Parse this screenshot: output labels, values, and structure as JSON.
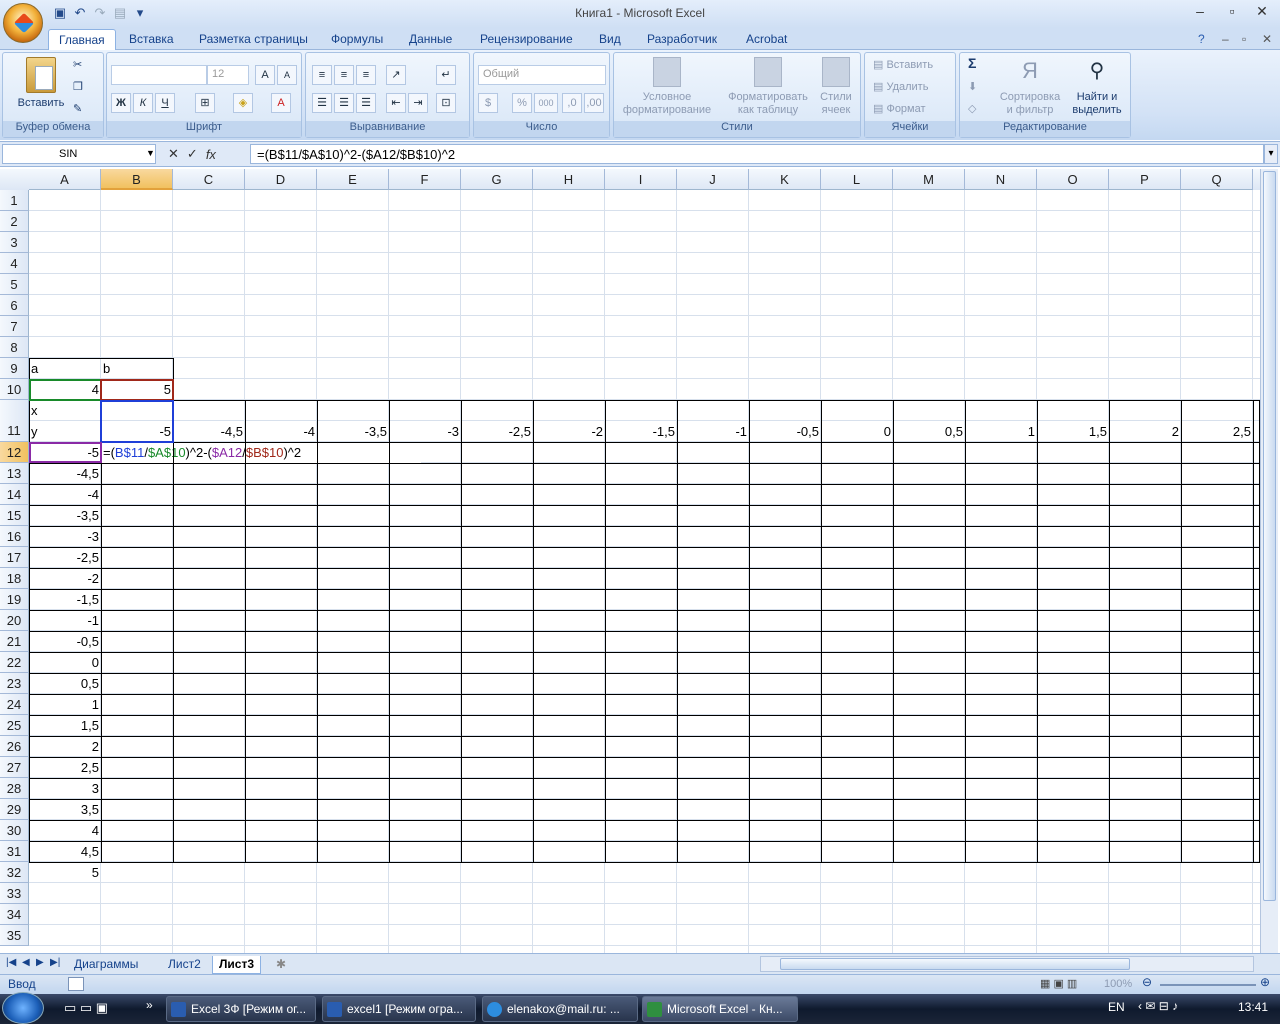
{
  "window": {
    "title": "Книга1 - Microsoft Excel"
  },
  "qat": {
    "icons": [
      "save-icon",
      "undo-icon",
      "redo-icon",
      "print-preview-icon",
      "customize-icon"
    ]
  },
  "ribbon": {
    "tabs": [
      "Главная",
      "Вставка",
      "Разметка страницы",
      "Формулы",
      "Данные",
      "Рецензирование",
      "Вид",
      "Разработчик",
      "Acrobat"
    ],
    "groups": {
      "clipboard": {
        "label": "Буфер обмена",
        "paste": "Вставить"
      },
      "font": {
        "label": "Шрифт",
        "size": "12",
        "bold": "Ж",
        "italic": "К",
        "underline": "Ч"
      },
      "alignment": {
        "label": "Выравнивание"
      },
      "number": {
        "label": "Число",
        "format": "Общий",
        "percent": "%",
        "thousands": "000"
      },
      "styles": {
        "label": "Стили",
        "cond_format_1": "Условное",
        "cond_format_2": "форматирование",
        "table_1": "Форматировать",
        "table_2": "как таблицу",
        "cell_1": "Стили",
        "cell_2": "ячеек"
      },
      "cells": {
        "label": "Ячейки",
        "insert": "Вставить",
        "delete": "Удалить",
        "format": "Формат"
      },
      "editing": {
        "label": "Редактирование",
        "sort_1": "Сортировка",
        "sort_2": "и фильтр",
        "find_1": "Найти и",
        "find_2": "выделить",
        "sigma": "Σ"
      }
    }
  },
  "formula_bar": {
    "name_box": "SIN",
    "formula": "=(B$11/$A$10)^2-($A12/$B$10)^2"
  },
  "columns": [
    "A",
    "B",
    "C",
    "D",
    "E",
    "F",
    "G",
    "H",
    "I",
    "J",
    "K",
    "L",
    "M",
    "N",
    "O",
    "P",
    "Q"
  ],
  "rows": [
    "1",
    "2",
    "3",
    "4",
    "5",
    "6",
    "7",
    "8",
    "9",
    "10",
    "11",
    "12",
    "13",
    "14",
    "15",
    "16",
    "17",
    "18",
    "19",
    "20",
    "21",
    "22",
    "23",
    "24",
    "25",
    "26",
    "27",
    "28",
    "29",
    "30",
    "31",
    "32",
    "33",
    "34",
    "35"
  ],
  "cells": {
    "a_label": "a",
    "b_label": "b",
    "a_value": "4",
    "b_value": "5",
    "x_label": "x",
    "y_label": "y",
    "x_values": [
      "-5",
      "-4,5",
      "-4",
      "-3,5",
      "-3",
      "-2,5",
      "-2",
      "-1,5",
      "-1",
      "-0,5",
      "0",
      "0,5",
      "1",
      "1,5",
      "2",
      "2,5"
    ],
    "y_values": [
      "-5",
      "-4,5",
      "-4",
      "-3,5",
      "-3",
      "-2,5",
      "-2",
      "-1,5",
      "-1",
      "-0,5",
      "0",
      "0,5",
      "1",
      "1,5",
      "2",
      "2,5",
      "3",
      "3,5",
      "4",
      "4,5",
      "5"
    ],
    "edit": {
      "p1": "=(",
      "ref1": "B$11",
      "op1": "/",
      "ref2": "$A$10",
      "p2": ")^2-(",
      "ref3": "$A12",
      "op2": "/",
      "ref4": "$B$10",
      "p3": ")^2"
    }
  },
  "sheets": [
    "Диаграммы",
    "Лист2",
    "Лист3"
  ],
  "active_sheet": "Лист3",
  "status": {
    "mode": "Ввод",
    "zoom": "100%"
  },
  "taskbar": {
    "items": [
      "Excel 3Ф [Режим ог...",
      "excel1 [Режим огра...",
      "elenakox@mail.ru: ...",
      "Microsoft Excel - Кн..."
    ],
    "lang": "EN",
    "time": "13:41"
  },
  "colors": {
    "ref_blue": "#1f3fd8",
    "ref_green": "#188a2a",
    "ref_purple": "#8a2aa6",
    "ref_red": "#a0281a"
  }
}
